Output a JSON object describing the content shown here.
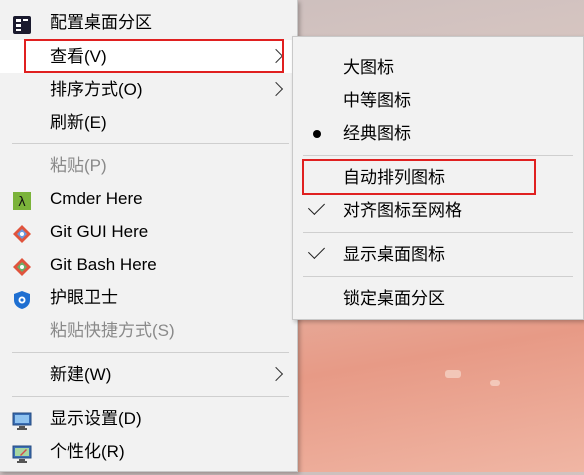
{
  "context_menu": {
    "items": [
      {
        "label": "配置桌面分区",
        "icon": "desktop-partition-icon"
      },
      {
        "label": "查看(V)",
        "has_submenu": true
      },
      {
        "label": "排序方式(O)",
        "has_submenu": true
      },
      {
        "label": "刷新(E)"
      },
      {
        "label": "粘贴(P)",
        "disabled": true
      },
      {
        "label": "Cmder Here",
        "icon": "cmder-icon"
      },
      {
        "label": "Git GUI Here",
        "icon": "git-icon"
      },
      {
        "label": "Git Bash Here",
        "icon": "git-icon"
      },
      {
        "label": "护眼卫士",
        "icon": "eye-shield-icon"
      },
      {
        "label": "粘贴快捷方式(S)",
        "disabled": true
      },
      {
        "label": "新建(W)",
        "has_submenu": true
      },
      {
        "label": "显示设置(D)",
        "icon": "display-settings-icon"
      },
      {
        "label": "个性化(R)",
        "icon": "personalize-icon"
      }
    ]
  },
  "view_submenu": {
    "items": [
      {
        "label": "大图标",
        "mark": "none"
      },
      {
        "label": "中等图标",
        "mark": "none"
      },
      {
        "label": "经典图标",
        "mark": "dot"
      },
      {
        "label": "自动排列图标",
        "mark": "none"
      },
      {
        "label": "对齐图标至网格",
        "mark": "check"
      },
      {
        "label": "显示桌面图标",
        "mark": "check"
      },
      {
        "label": "锁定桌面分区",
        "mark": "none"
      }
    ]
  },
  "colors": {
    "highlight_box": "#e02020",
    "menu_bg": "#f2f2f2",
    "disabled_text": "#8a8a8a"
  }
}
